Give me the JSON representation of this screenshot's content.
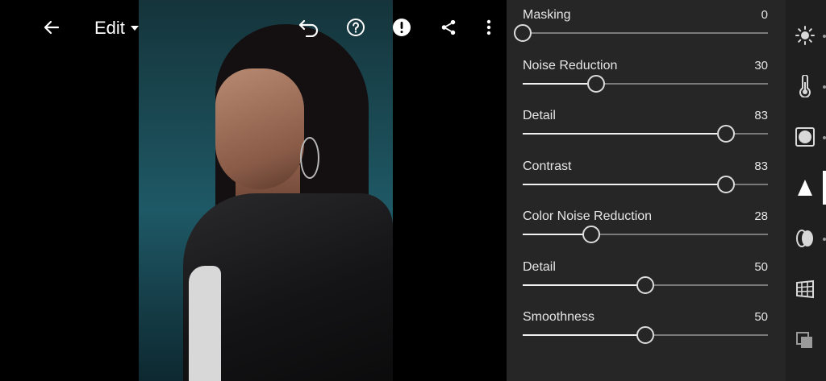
{
  "header": {
    "edit_label": "Edit",
    "icons": [
      "back-arrow-icon",
      "dropdown-caret-icon",
      "undo-icon",
      "help-icon",
      "alert-icon",
      "share-icon",
      "more-vert-icon"
    ]
  },
  "sliders": [
    {
      "label": "Masking",
      "value": "0",
      "fraction": 0.0
    },
    {
      "label": "Noise Reduction",
      "value": "30",
      "fraction": 0.3
    },
    {
      "label": "Detail",
      "value": "83",
      "fraction": 0.83
    },
    {
      "label": "Contrast",
      "value": "83",
      "fraction": 0.83
    },
    {
      "label": "Color Noise Reduction",
      "value": "28",
      "fraction": 0.28
    },
    {
      "label": "Detail",
      "value": "50",
      "fraction": 0.5
    },
    {
      "label": "Smoothness",
      "value": "50",
      "fraction": 0.5
    }
  ],
  "rail": {
    "tools": [
      "light-icon",
      "color-temperature-icon",
      "effects-vignette-icon",
      "detail-triangle-icon",
      "optics-lens-icon",
      "geometry-grid-icon",
      "presets-layers-icon"
    ],
    "active": "detail-triangle-icon"
  },
  "colors": {
    "panel_bg": "#262626",
    "track": "#7a7a7a",
    "fill": "#f2f2f2",
    "accent": "#ffffff"
  }
}
